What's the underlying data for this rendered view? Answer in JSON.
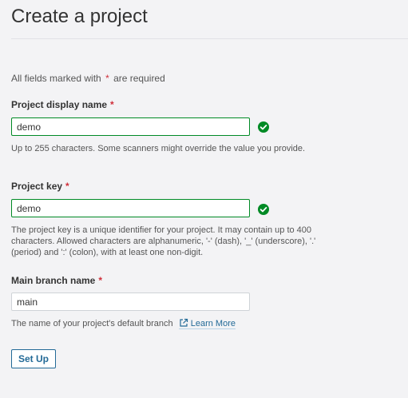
{
  "page": {
    "title": "Create a project"
  },
  "required_note": {
    "prefix": "All fields marked with",
    "asterisk": "*",
    "suffix": "are required"
  },
  "fields": {
    "display_name": {
      "label": "Project display name",
      "required_mark": "*",
      "value": "demo",
      "status_icon": "check-circle-icon",
      "help": "Up to 255 characters. Some scanners might override the value you provide."
    },
    "project_key": {
      "label": "Project key",
      "required_mark": "*",
      "value": "demo",
      "status_icon": "check-circle-icon",
      "help": "The project key is a unique identifier for your project. It may contain up to 400 characters. Allowed characters are alphanumeric, '-' (dash), '_' (underscore), '.' (period) and ':' (colon), with at least one non-digit."
    },
    "main_branch": {
      "label": "Main branch name",
      "required_mark": "*",
      "value": "main",
      "help": "The name of your project's default branch",
      "link_label": "Learn More",
      "link_icon": "external-link-icon"
    }
  },
  "actions": {
    "setup_label": "Set Up"
  },
  "colors": {
    "background": "#f3f3f5",
    "valid_green": "#008a25",
    "required_red": "#d02f3a",
    "link_blue": "#236a97",
    "text": "#333333"
  }
}
